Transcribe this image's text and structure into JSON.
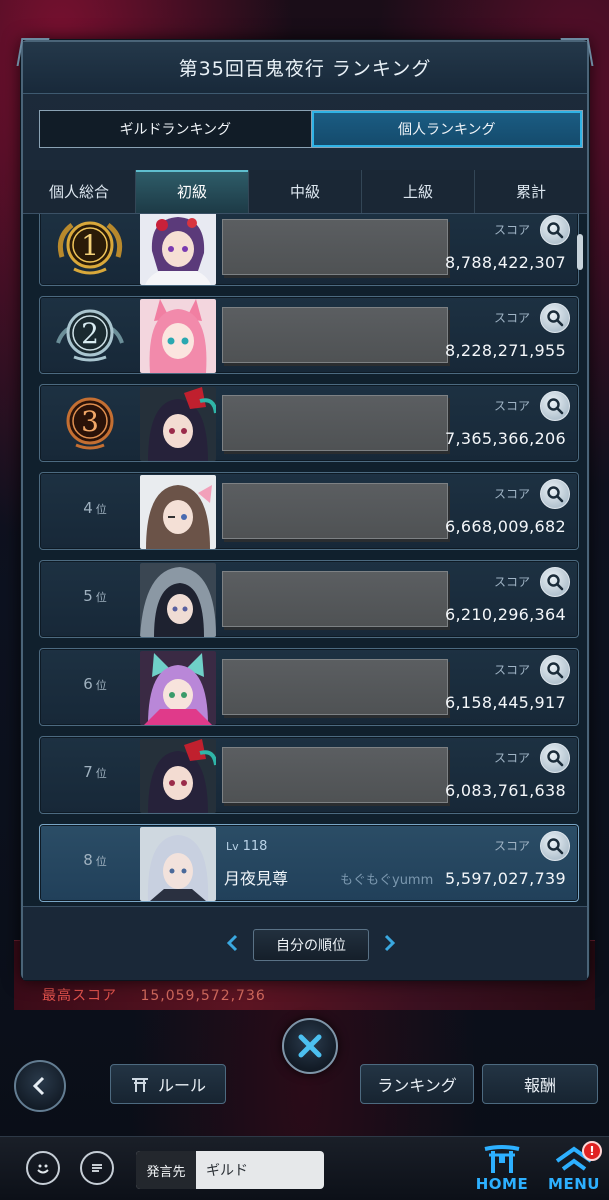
{
  "title": "第35回百鬼夜行 ランキング",
  "segments": [
    "ギルドランキング",
    "個人ランキング"
  ],
  "active_segment": 1,
  "tabs": [
    "個人総合",
    "初級",
    "中級",
    "上級",
    "累計"
  ],
  "active_tab": 1,
  "score_label": "スコア",
  "rank_suffix": "位",
  "rows": [
    {
      "rank": "1",
      "score": "8,788,422,307"
    },
    {
      "rank": "2",
      "score": "8,228,271,955"
    },
    {
      "rank": "3",
      "score": "7,365,366,206"
    },
    {
      "rank": "4",
      "score": "6,668,009,682"
    },
    {
      "rank": "5",
      "score": "6,210,296,364"
    },
    {
      "rank": "6",
      "score": "6,158,445,917"
    },
    {
      "rank": "7",
      "score": "6,083,761,638"
    }
  ],
  "me": {
    "rank": "8",
    "level_label": "Lv",
    "level": "118",
    "name": "月夜見尊",
    "guild": "もぐもぐyumm",
    "score": "5,597,027,739"
  },
  "pager": {
    "my_rank_label": "自分の順位"
  },
  "background": {
    "best_score_label": "最高スコア",
    "best_score_value": "15,059,572,736"
  },
  "bottom": {
    "rule_label": "ルール",
    "ranking_label": "ランキング",
    "reward_label": "報酬"
  },
  "footer": {
    "chat_target_label": "発言先",
    "chat_target_value": "ギルド",
    "home_label": "HOME",
    "menu_label": "MENU",
    "menu_badge": "!"
  },
  "colors": {
    "accent": "#2fb3e6",
    "nav_blue": "#2db0ff",
    "badge_red": "#e02222"
  }
}
